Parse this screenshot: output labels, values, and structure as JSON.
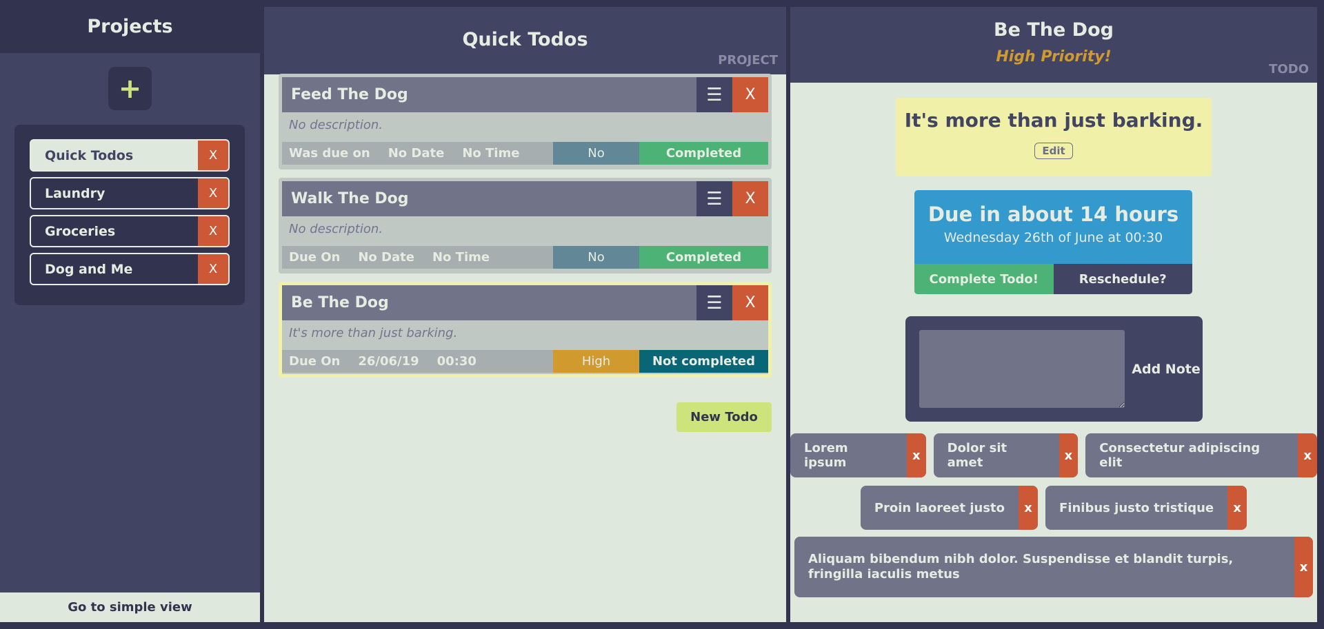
{
  "sidebar": {
    "title": "Projects",
    "add_label": "+",
    "projects": [
      {
        "label": "Quick Todos",
        "active": true
      },
      {
        "label": "Laundry"
      },
      {
        "label": "Groceries"
      },
      {
        "label": "Dog and Me"
      }
    ],
    "delete_label": "X",
    "simple_view": "Go to simple view"
  },
  "project": {
    "title": "Quick Todos",
    "tag": "PROJECT",
    "new_todo": "New Todo",
    "todos": [
      {
        "title": "Feed The Dog",
        "description": "No description.",
        "due_label": "Was due on",
        "date": "No Date",
        "time": "No Time",
        "priority": "No",
        "status": "Completed",
        "priority_color": "#628898",
        "status_color": "#4cb276"
      },
      {
        "title": "Walk The Dog",
        "description": "No description.",
        "due_label": "Due On",
        "date": "No Date",
        "time": "No Time",
        "priority": "No",
        "status": "Completed",
        "priority_color": "#628898",
        "status_color": "#4cb276"
      },
      {
        "title": "Be The Dog",
        "description": "It's more than just barking.",
        "due_label": "Due On",
        "date": "26/06/19",
        "time": "00:30",
        "priority": "High",
        "status": "Not completed",
        "priority_color": "#d19a2e",
        "status_color": "#086677",
        "selected": true
      }
    ],
    "delete_label": "X",
    "menu_icon": "hamburger-icon"
  },
  "todo": {
    "title": "Be The Dog",
    "priority_text": "High Priority!",
    "tag": "TODO",
    "description": "It's more than just barking.",
    "edit": "Edit",
    "due_text": "Due in about 14 hours",
    "due_date": "Wednesday 26th of June at 00:30",
    "complete": "Complete Todo!",
    "reschedule": "Reschedule?",
    "add_note": "Add Note",
    "notes": [
      "Lorem ipsum",
      "Dolor sit amet",
      "Consectetur adipiscing elit",
      "Proin laoreet justo",
      "Finibus justo tristique",
      "Aliquam bibendum nibh dolor. Suspendisse et blandit turpis, fringilla iaculis metus"
    ],
    "note_delete": "x"
  },
  "colors": {
    "accent_green": "#cde47d",
    "danger": "#cc5835",
    "dark": "#32344f",
    "panel": "#424464",
    "content": "#dfe8dc",
    "due_blue": "#3499cc",
    "priority_high": "#d19a2e"
  }
}
